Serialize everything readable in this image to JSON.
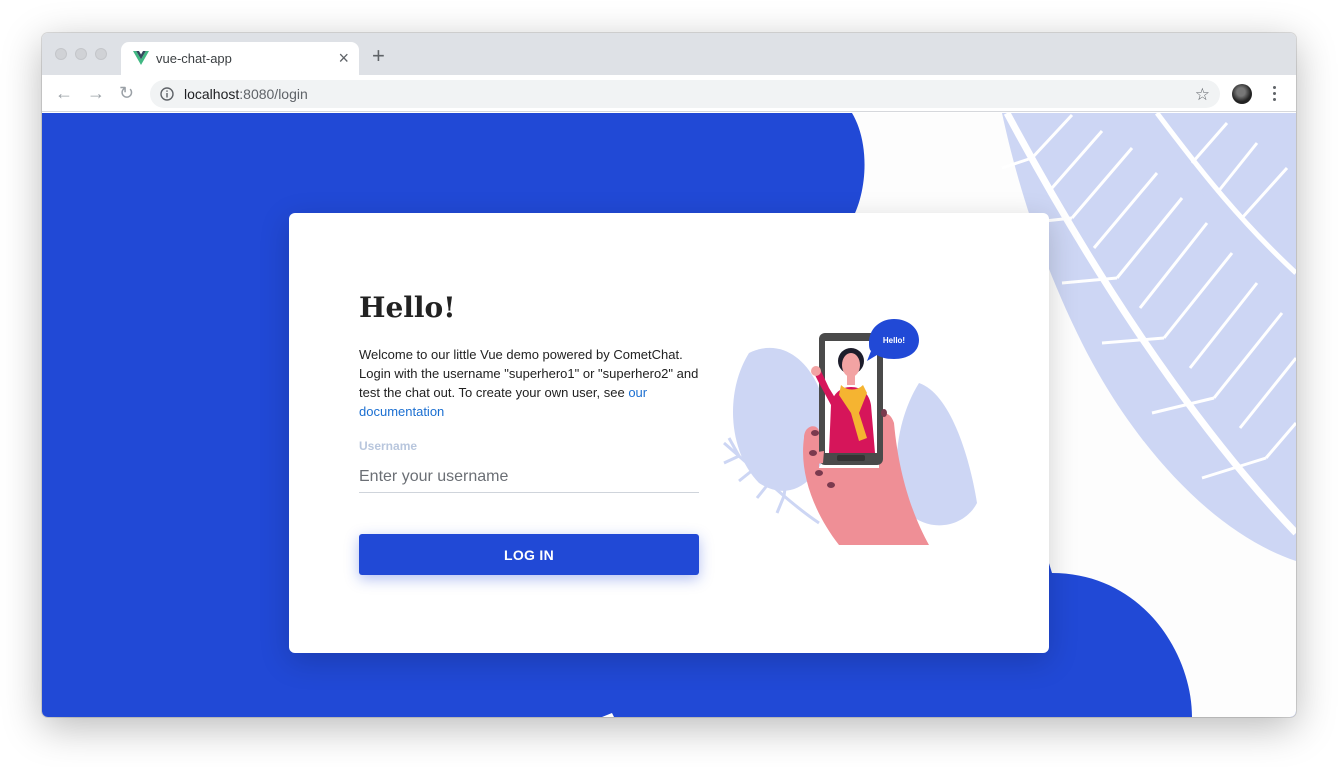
{
  "browser": {
    "tab_title": "vue-chat-app",
    "tab_close": "×",
    "new_tab": "+",
    "url_host": "localhost",
    "url_rest": ":8080/login",
    "back": "←",
    "forward": "→",
    "reload": "↻",
    "star": "☆",
    "favicon": "vue-logo-icon",
    "colors": {
      "tabbar": "#dee1e6",
      "omnibox": "#f1f3f4"
    }
  },
  "page": {
    "colors": {
      "primary": "#2149d6",
      "leaf": "#cdd6f4",
      "link": "#1b6fd1",
      "label": "#b8c6dd"
    },
    "heading": "Hello!",
    "intro_text": "Welcome to our little Vue demo powered by CometChat. Login with the username \"superhero1\" or \"superhero2\" and test the chat out. To create your own user, see ",
    "intro_link": "our documentation",
    "username_label": "Username",
    "username_placeholder": "Enter your username",
    "login_button": "LOG IN",
    "speech_bubble": "Hello!"
  }
}
